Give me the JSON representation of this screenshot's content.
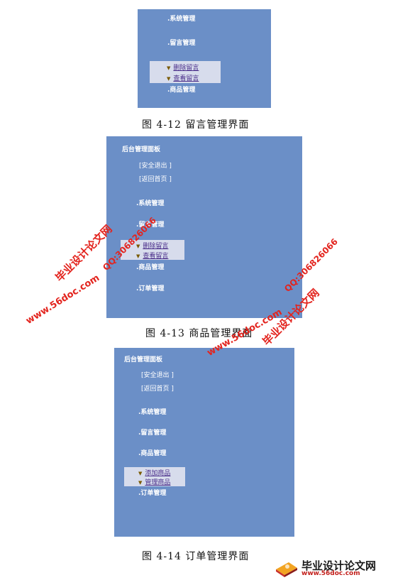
{
  "fig12": {
    "menu": {
      "system": ".系统管理",
      "message": ".留言管理",
      "goods": ".商品管理"
    },
    "sub": [
      "删除留言",
      "查看留言"
    ],
    "caption": "图 4-12   留言管理界面"
  },
  "fig13": {
    "title": "后台管理面板",
    "logout": "[安全退出 ]",
    "home": "[返回首页 ]",
    "menu": {
      "system": ".系统管理",
      "message": ".留言管理",
      "goods": ".商品管理",
      "orders": ".订单管理"
    },
    "sub": [
      "删除留言",
      "查看留言"
    ],
    "caption": "图 4-13   商品管理界面"
  },
  "fig14": {
    "title": "后台管理面板",
    "logout": "[安全退出 ]",
    "home": "[返回首页 ]",
    "menu": {
      "system": ".系统管理",
      "message": ".留言管理",
      "goods": ".商品管理",
      "orders": ".订单管理"
    },
    "sub": [
      "添加商品",
      "管理商品"
    ],
    "caption": "图 4-14   订单管理界面"
  },
  "watermarks": {
    "w1_name": "毕业设计论文网",
    "w1_qq": "QQ:306826066",
    "w1_url": "www.56doc.com",
    "w2_name": "毕业设计论文网",
    "w2_qq": "QQ:306826066",
    "w2_url": "www.56doc.com"
  },
  "logo": {
    "title": "毕业设计论文网",
    "url": "www.56doc.com"
  },
  "colors": {
    "panel": "#6b8fc7",
    "submenu": "#d7dcec",
    "watermark": "#e3241e"
  }
}
